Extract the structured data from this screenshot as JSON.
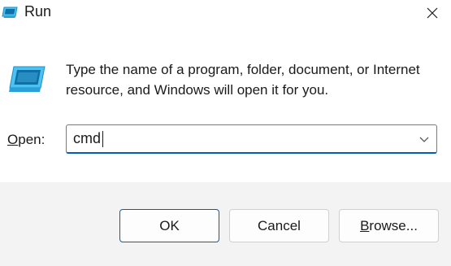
{
  "window": {
    "title": "Run",
    "title_icon": "run-app-icon",
    "close_icon": "close-icon"
  },
  "content": {
    "icon": "run-app-icon",
    "description": "Type the name of a program, folder, document, or Internet resource, and Windows will open it for you.",
    "open_label_accel": "O",
    "open_label_rest": "pen:",
    "open_value": "cmd",
    "dropdown_icon": "chevron-down-icon"
  },
  "buttons": {
    "ok_label": "OK",
    "cancel_label": "Cancel",
    "browse_label_accel": "B",
    "browse_label_rest": "rowse..."
  },
  "colors": {
    "accent": "#005fb8",
    "footer_bg": "#f3f3f3",
    "icon_blue": "#4cc2f1"
  }
}
